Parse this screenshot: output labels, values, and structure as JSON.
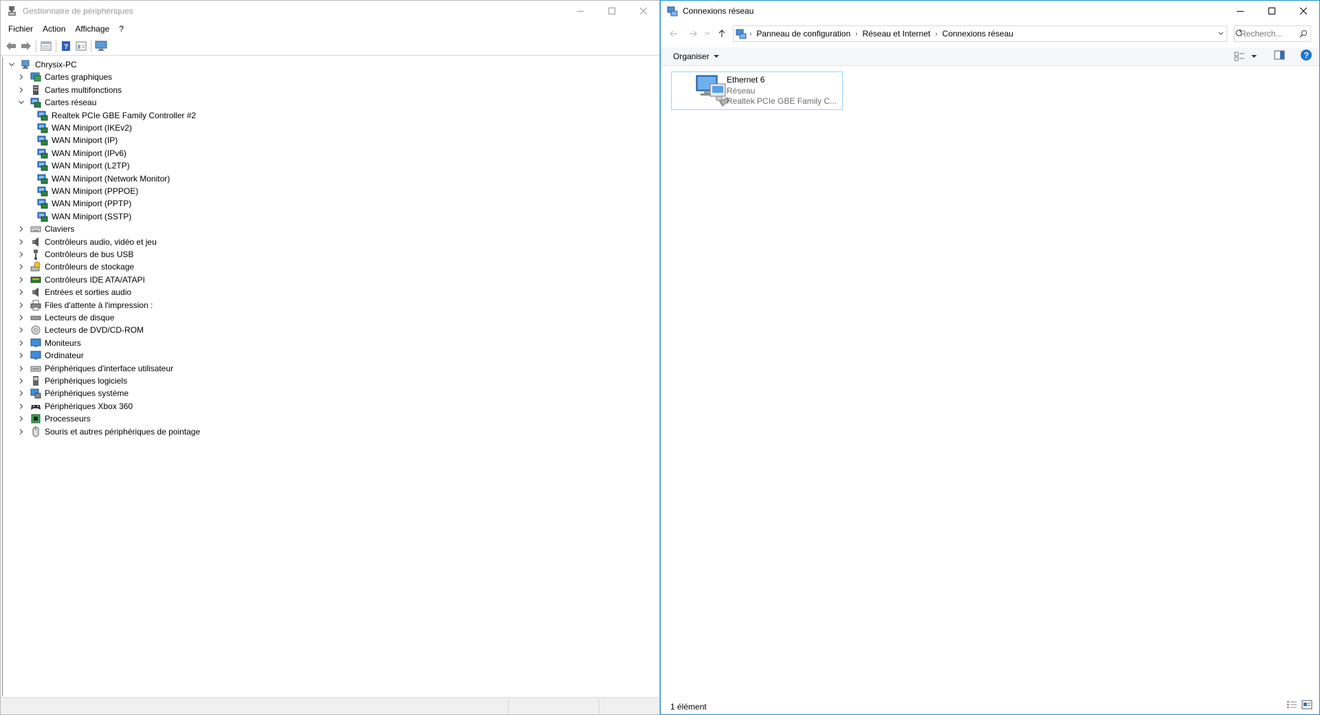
{
  "devmgr": {
    "title": "Gestionnaire de périphériques",
    "menu": [
      "Fichier",
      "Action",
      "Affichage",
      "?"
    ],
    "tree": [
      {
        "level": 0,
        "label": "Chrysix-PC",
        "expanded": true,
        "icon": "computer-icon"
      },
      {
        "level": 1,
        "label": "Cartes graphiques",
        "expanded": false,
        "icon": "display-adapter-icon"
      },
      {
        "level": 1,
        "label": "Cartes multifonctions",
        "expanded": false,
        "icon": "multifunction-icon"
      },
      {
        "level": 1,
        "label": "Cartes réseau",
        "expanded": true,
        "icon": "network-adapter-icon"
      },
      {
        "level": 2,
        "label": "Realtek PCIe GBE Family Controller #2",
        "icon": "network-adapter-icon"
      },
      {
        "level": 2,
        "label": "WAN Miniport (IKEv2)",
        "icon": "network-adapter-icon"
      },
      {
        "level": 2,
        "label": "WAN Miniport (IP)",
        "icon": "network-adapter-icon"
      },
      {
        "level": 2,
        "label": "WAN Miniport (IPv6)",
        "icon": "network-adapter-icon"
      },
      {
        "level": 2,
        "label": "WAN Miniport (L2TP)",
        "icon": "network-adapter-icon"
      },
      {
        "level": 2,
        "label": "WAN Miniport (Network Monitor)",
        "icon": "network-adapter-icon"
      },
      {
        "level": 2,
        "label": "WAN Miniport (PPPOE)",
        "icon": "network-adapter-icon"
      },
      {
        "level": 2,
        "label": "WAN Miniport (PPTP)",
        "icon": "network-adapter-icon"
      },
      {
        "level": 2,
        "label": "WAN Miniport (SSTP)",
        "icon": "network-adapter-icon"
      },
      {
        "level": 1,
        "label": "Claviers",
        "expanded": false,
        "icon": "keyboard-icon"
      },
      {
        "level": 1,
        "label": "Contrôleurs audio, vidéo et jeu",
        "expanded": false,
        "icon": "speaker-icon"
      },
      {
        "level": 1,
        "label": "Contrôleurs de bus USB",
        "expanded": false,
        "icon": "usb-icon"
      },
      {
        "level": 1,
        "label": "Contrôleurs de stockage",
        "expanded": false,
        "icon": "storage-icon"
      },
      {
        "level": 1,
        "label": "Contrôleurs IDE ATA/ATAPI",
        "expanded": false,
        "icon": "ide-icon"
      },
      {
        "level": 1,
        "label": "Entrées et sorties audio",
        "expanded": false,
        "icon": "speaker-icon"
      },
      {
        "level": 1,
        "label": "Files d'attente à l'impression :",
        "expanded": false,
        "icon": "printer-icon"
      },
      {
        "level": 1,
        "label": "Lecteurs de disque",
        "expanded": false,
        "icon": "disk-icon"
      },
      {
        "level": 1,
        "label": "Lecteurs de DVD/CD-ROM",
        "expanded": false,
        "icon": "dvd-icon"
      },
      {
        "level": 1,
        "label": "Moniteurs",
        "expanded": false,
        "icon": "monitor-icon"
      },
      {
        "level": 1,
        "label": "Ordinateur",
        "expanded": false,
        "icon": "monitor-icon"
      },
      {
        "level": 1,
        "label": "Périphériques d'interface utilisateur",
        "expanded": false,
        "icon": "hid-icon"
      },
      {
        "level": 1,
        "label": "Périphériques logiciels",
        "expanded": false,
        "icon": "software-device-icon"
      },
      {
        "level": 1,
        "label": "Périphériques système",
        "expanded": false,
        "icon": "system-device-icon"
      },
      {
        "level": 1,
        "label": "Périphériques Xbox 360",
        "expanded": false,
        "icon": "gamepad-icon"
      },
      {
        "level": 1,
        "label": "Processeurs",
        "expanded": false,
        "icon": "cpu-icon"
      },
      {
        "level": 1,
        "label": "Souris et autres périphériques de pointage",
        "expanded": false,
        "icon": "mouse-icon"
      }
    ]
  },
  "netconn": {
    "title": "Connexions réseau",
    "breadcrumb": [
      "Panneau de configuration",
      "Réseau et Internet",
      "Connexions réseau"
    ],
    "search_placeholder": "Recherch...",
    "organize_label": "Organiser",
    "item": {
      "name": "Ethernet 6",
      "network": "Réseau",
      "device": "Realtek PCIe GBE Family C..."
    },
    "status": "1 élément"
  },
  "colors": {
    "accent": "#1d8ad6",
    "selection_border": "#99d1ff",
    "help_blue": "#1e76d2"
  }
}
